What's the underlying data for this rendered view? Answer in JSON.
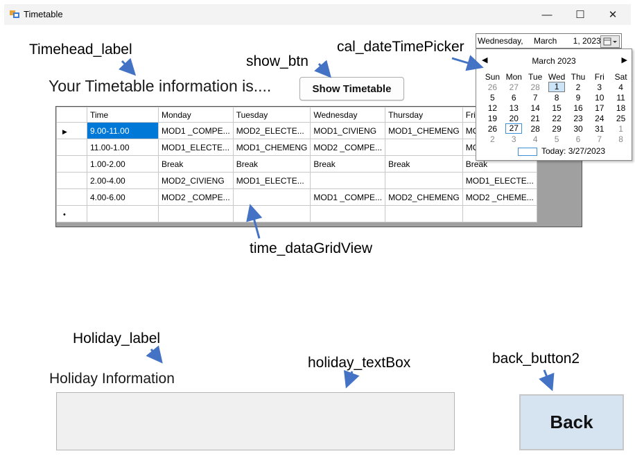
{
  "window": {
    "title": "Timetable",
    "controls": {
      "minimize": "—",
      "maximize": "☐",
      "close": "✕"
    }
  },
  "annotations": {
    "timehead_label": "Timehead_label",
    "show_btn": "show_btn",
    "cal_datetimepicker": "cal_dateTimePicker",
    "time_datagridview": "time_dataGridView",
    "holiday_label": "Holiday_label",
    "holiday_textbox": "holiday_textBox",
    "back_button2": "back_button2",
    "arrow_color": "#4472c4"
  },
  "header": {
    "timetable_info": "Your Timetable information is....",
    "show_button": "Show Timetable"
  },
  "date_picker": {
    "value_day": "Wednesday,",
    "value_month": "March",
    "value_date": "1, 2023"
  },
  "calendar": {
    "month_title": "March 2023",
    "prev": "◀",
    "next": "▶",
    "weekdays": [
      "Sun",
      "Mon",
      "Tue",
      "Wed",
      "Thu",
      "Fri",
      "Sat"
    ],
    "weeks": [
      [
        "26",
        "27",
        "28",
        "1",
        "2",
        "3",
        "4"
      ],
      [
        "5",
        "6",
        "7",
        "8",
        "9",
        "10",
        "11"
      ],
      [
        "12",
        "13",
        "14",
        "15",
        "16",
        "17",
        "18"
      ],
      [
        "19",
        "20",
        "21",
        "22",
        "23",
        "24",
        "25"
      ],
      [
        "26",
        "27",
        "28",
        "29",
        "30",
        "31",
        "1"
      ],
      [
        "2",
        "3",
        "4",
        "5",
        "6",
        "7",
        "8"
      ]
    ],
    "today_label": "Today: 3/27/2023"
  },
  "grid": {
    "headers": [
      "Time",
      "Monday",
      "Tuesday",
      "Wednesday",
      "Thursday",
      "Friday"
    ],
    "rows": [
      [
        "9.00-11.00",
        "MOD1 _COMPE...",
        "MOD2_ELECTE...",
        "MOD1_CIVIENG",
        "MOD1_CHEMENG",
        "MOD1 _"
      ],
      [
        "11.00-1.00",
        "MOD1_ELECTE...",
        "MOD1_CHEMENG",
        "MOD2 _COMPE...",
        "",
        "MOD1_"
      ],
      [
        "1.00-2.00",
        "Break",
        "Break",
        "Break",
        "Break",
        "Break"
      ],
      [
        "2.00-4.00",
        "MOD2_CIVIENG",
        "MOD1_ELECTE...",
        "",
        "",
        "MOD1_ELECTE..."
      ],
      [
        "4.00-6.00",
        "MOD2 _COMPE...",
        "",
        "MOD1 _COMPE...",
        "MOD2_CHEMENG",
        "MOD2 _CHEME..."
      ]
    ],
    "current_row_marker": "▶",
    "new_row_marker": "•"
  },
  "holiday": {
    "label": "Holiday Information",
    "textbox_value": ""
  },
  "back_button": {
    "label": "Back"
  }
}
